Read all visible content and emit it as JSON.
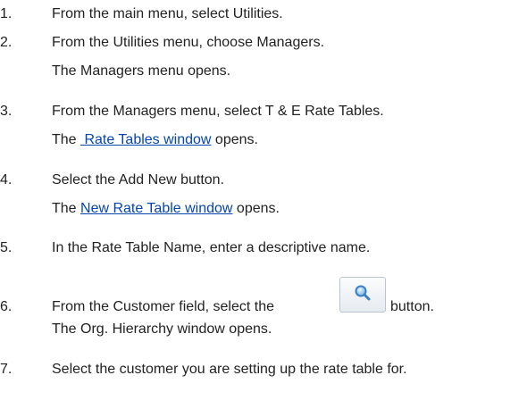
{
  "steps": [
    {
      "number": "1.",
      "text": "From the main menu, select Utilities."
    },
    {
      "number": "2.",
      "text": "From the Utilities menu, choose Managers.",
      "result": "The Managers menu opens."
    },
    {
      "number": "3.",
      "text": "From the Managers menu, select T & E Rate Tables.",
      "result_prefix": "The ",
      "link": "Rate Tables window",
      "result_suffix": " opens."
    },
    {
      "number": "4.",
      "text": "Select the Add New button.",
      "result_prefix": "The ",
      "link": "New Rate Table window",
      "result_suffix": " opens."
    },
    {
      "number": "5.",
      "text": "In the Rate Table Name, enter a descriptive name."
    },
    {
      "number": "6.",
      "text_before": "From the Customer field, select the",
      "icon": "search-icon",
      "text_after": "button.",
      "result": "The Org. Hierarchy window opens."
    },
    {
      "number": "7.",
      "text": "Select the customer you are setting up the rate table for."
    }
  ]
}
